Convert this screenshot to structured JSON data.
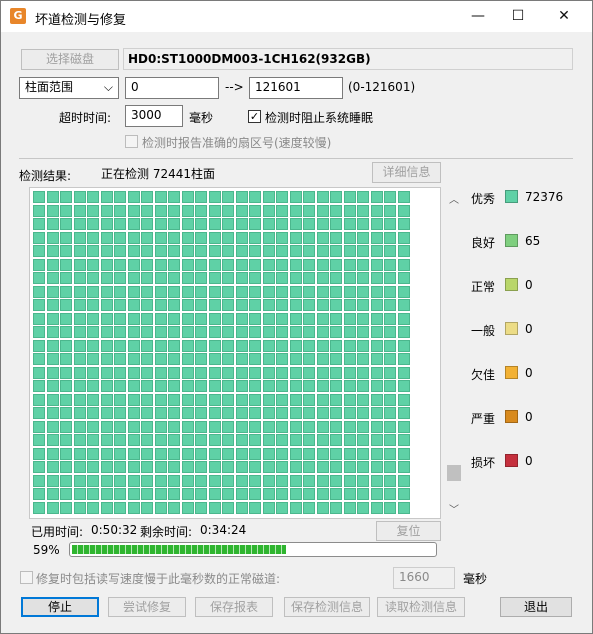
{
  "window": {
    "title": "坏道检测与修复",
    "app_icon_glyph": "G",
    "controls": {
      "minimize": "—",
      "maximize": "☐",
      "close": "✕"
    }
  },
  "disk": {
    "select_button": "选择磁盘",
    "name": "HD0:ST1000DM003-1CH162(932GB)"
  },
  "range": {
    "mode": "柱面范围",
    "from": "0",
    "arrow": "-->",
    "to": "121601",
    "hint": "(0-121601)"
  },
  "timeout": {
    "label": "超时时间:",
    "value": "3000",
    "unit": "毫秒",
    "prevent_sleep_label": "检测时阻止系统睡眠",
    "prevent_sleep_checked": true,
    "report_sector_label": "检测时报告准确的扇区号(速度较慢)",
    "report_sector_checked": false
  },
  "result": {
    "label": "检测结果:",
    "status": "正在检测 72441柱面",
    "detail_button": "详细信息"
  },
  "legend": [
    {
      "name": "优秀",
      "color": "#5fd1a6",
      "count": "72376"
    },
    {
      "name": "良好",
      "color": "#7fcf7f",
      "count": "65"
    },
    {
      "name": "正常",
      "color": "#b9d66a",
      "count": "0"
    },
    {
      "name": "一般",
      "color": "#ecdc86",
      "count": "0"
    },
    {
      "name": "欠佳",
      "color": "#f2b134",
      "count": "0"
    },
    {
      "name": "严重",
      "color": "#d88a1e",
      "count": "0"
    },
    {
      "name": "损坏",
      "color": "#c5303d",
      "count": "0"
    }
  ],
  "grid": {
    "columns": 28,
    "rows": 24,
    "cell_color": "#5fd1a6"
  },
  "time": {
    "elapsed_label": "已用时间:",
    "elapsed": "0:50:32",
    "remaining_label": "剩余时间:",
    "remaining": "0:34:24",
    "reset_button": "复位"
  },
  "progress": {
    "text": "59%",
    "value": 59
  },
  "repair_option": {
    "label": "修复时包括读写速度慢于此毫秒数的正常磁道:",
    "checked": false,
    "value": "1660",
    "unit": "毫秒"
  },
  "buttons": {
    "stop": "停止",
    "try_repair": "尝试修复",
    "save_report": "保存报表",
    "save_info": "保存检测信息",
    "load_info": "读取检测信息",
    "exit": "退出"
  }
}
